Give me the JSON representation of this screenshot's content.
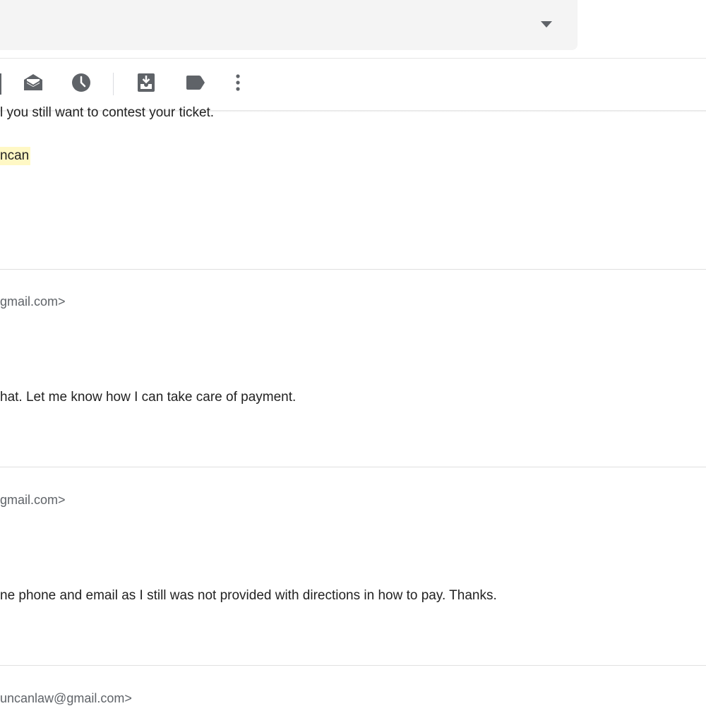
{
  "search": {
    "options_icon": "caret-down-icon"
  },
  "toolbar": {
    "buttons": [
      {
        "name": "mark-unread",
        "icon": "envelope-open-icon"
      },
      {
        "name": "snooze",
        "icon": "clock-icon"
      },
      {
        "name": "move-to",
        "icon": "move-to-inbox-icon"
      },
      {
        "name": "labels",
        "icon": "label-icon"
      },
      {
        "name": "more",
        "icon": "more-vert-icon"
      }
    ],
    "icon_color": "#5f6368"
  },
  "messages": [
    {
      "body_line_1": "l you still want to contest your ticket.",
      "signature": "ncan"
    },
    {
      "sender_email": "gmail.com>",
      "body": "hat. Let me know how I can take care of payment."
    },
    {
      "sender_email": "gmail.com>",
      "body": "ne phone and email as I still was not provided with directions in how to pay. Thanks."
    },
    {
      "sender_email": "uncanlaw@gmail.com>"
    }
  ],
  "colors": {
    "highlight": "#fff8c5",
    "search_bg": "#f4f4f4",
    "divider": "#e0e0e0"
  }
}
